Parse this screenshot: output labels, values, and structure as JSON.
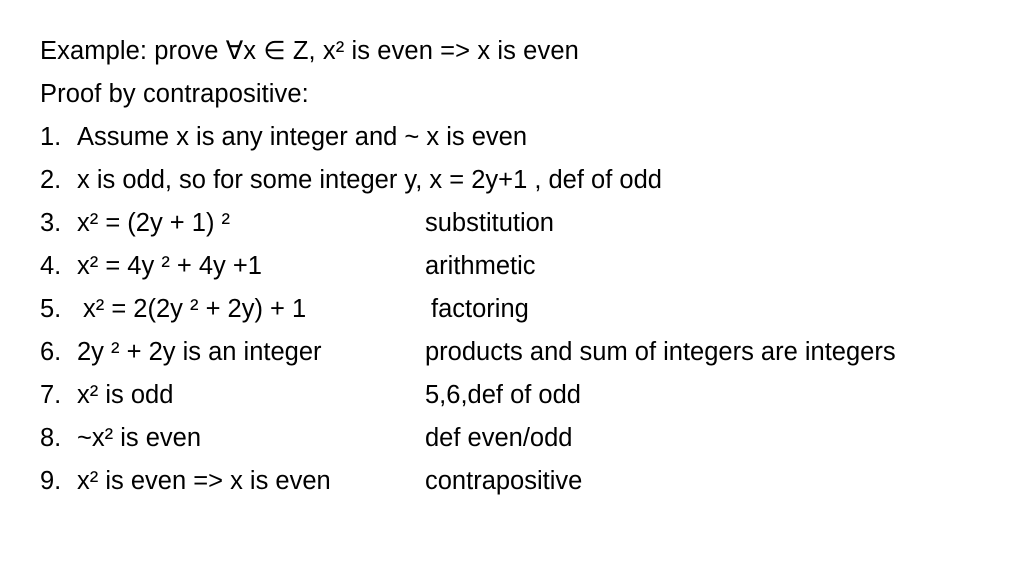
{
  "slide": {
    "heading_lines": [
      "Example: prove ∀x ∈ Z, x² is even => x is even",
      "Proof by contrapositive:"
    ],
    "heading_1_parts": {
      "before": "Example: prove ∀x ∈ Z, x",
      "exponent": "2",
      "after": " is even => x is even"
    },
    "heading_2": "Proof by contrapositive:",
    "proof_steps": [
      {
        "number": "1.",
        "statement": "Assume x is any integer and ~ x is even",
        "reason": ""
      },
      {
        "number": "2.",
        "statement": "x is odd, so for some integer y, x = 2y+1 , def of odd",
        "reason": ""
      },
      {
        "number": "3.",
        "statement": "x² = (2y + 1) ²",
        "reason": "substitution"
      },
      {
        "number": "4.",
        "statement": "x²  = 4y ² + 4y +1",
        "reason": "arithmetic"
      },
      {
        "number": "5.",
        "statement": "x²  = 2(2y ²  + 2y) + 1",
        "reason": "factoring"
      },
      {
        "number": "6.",
        "statement": "2y ²  + 2y is an integer",
        "reason": "products and sum of integers are integers"
      },
      {
        "number": "7.",
        "statement": "x² is odd",
        "reason": "5,6,def of odd"
      },
      {
        "number": "8.",
        "statement": "~x² is even",
        "reason": "def even/odd"
      },
      {
        "number": "9.",
        "statement": "x² is even => x is even",
        "reason": "contrapositive"
      }
    ],
    "colors": {
      "background": "#ffffff",
      "text": "#000000"
    }
  }
}
